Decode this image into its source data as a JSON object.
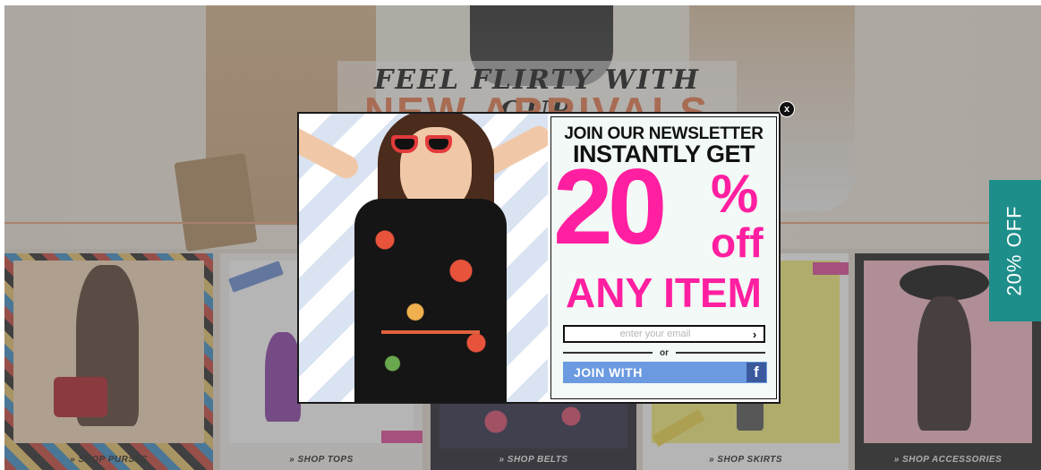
{
  "hero": {
    "headline": "FEEL FLIRTY WITH OUR",
    "subheadline": "NEW ARRIVALS"
  },
  "categories": [
    {
      "label": "» SHOP PURSES"
    },
    {
      "label": "» SHOP TOPS"
    },
    {
      "label": "» SHOP BELTS"
    },
    {
      "label": "» SHOP SKIRTS"
    },
    {
      "label": "» SHOP ACCESSORIES"
    }
  ],
  "side_tab": {
    "label": "20% OFF"
  },
  "popup": {
    "close_label": "x",
    "line1": "JOIN OUR NEWSLETTER",
    "line2": "INSTANTLY GET",
    "discount_number": "20",
    "percent_sign": "%",
    "off_text": "off",
    "any_item": "ANY ITEM",
    "email_placeholder": "enter your email",
    "submit_arrow": "›",
    "or_text": "or",
    "join_with_label": "JOIN WITH",
    "facebook_glyph": "f"
  },
  "colors": {
    "accent_pink": "#ff1fa0",
    "side_tab_teal": "#1e8e8a",
    "facebook_blue": "#6b9ae0",
    "hero_orange": "#e77b4f"
  }
}
